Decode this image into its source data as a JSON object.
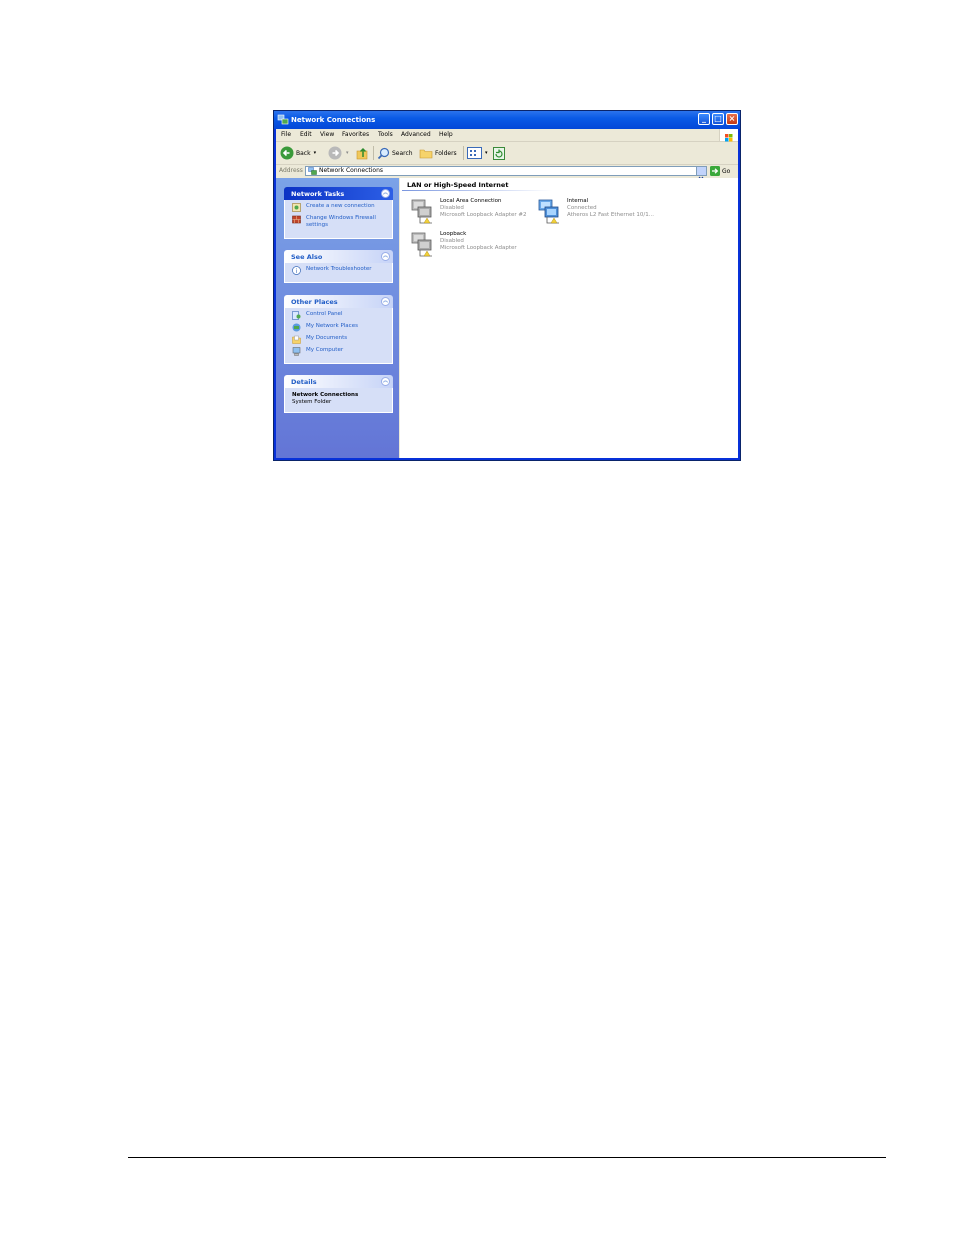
{
  "window": {
    "title": "Network Connections",
    "buttons": {
      "minimize": "_",
      "maximize": "□",
      "close": "×"
    }
  },
  "menu": [
    "File",
    "Edit",
    "View",
    "Favorites",
    "Tools",
    "Advanced",
    "Help"
  ],
  "toolbar": {
    "back": "Back",
    "search": "Search",
    "folders": "Folders"
  },
  "address": {
    "label": "Address",
    "value": "Network Connections",
    "go": "Go"
  },
  "taskpane": {
    "network_tasks": {
      "title": "Network Tasks",
      "items": [
        "Create a new connection",
        "Change Windows Firewall settings"
      ]
    },
    "see_also": {
      "title": "See Also",
      "items": [
        "Network Troubleshooter"
      ]
    },
    "other_places": {
      "title": "Other Places",
      "items": [
        "Control Panel",
        "My Network Places",
        "My Documents",
        "My Computer"
      ]
    },
    "details": {
      "title": "Details",
      "name": "Network Connections",
      "type": "System Folder"
    }
  },
  "content": {
    "group": "LAN or High-Speed Internet",
    "connections": [
      {
        "name": "Local Area Connection",
        "status": "Disabled",
        "device": "Microsoft Loopback Adapter #2"
      },
      {
        "name": "Internal",
        "status": "Connected",
        "device": "Atheros L2 Fast Ethernet 10/1..."
      },
      {
        "name": "Loopback",
        "status": "Disabled",
        "device": "Microsoft Loopback Adapter"
      }
    ]
  },
  "colors": {
    "titlebar": "#0a5ae6",
    "taskpane_top": "#7ba2e7",
    "taskpane_bottom": "#6375d6",
    "link": "#215dc6"
  }
}
